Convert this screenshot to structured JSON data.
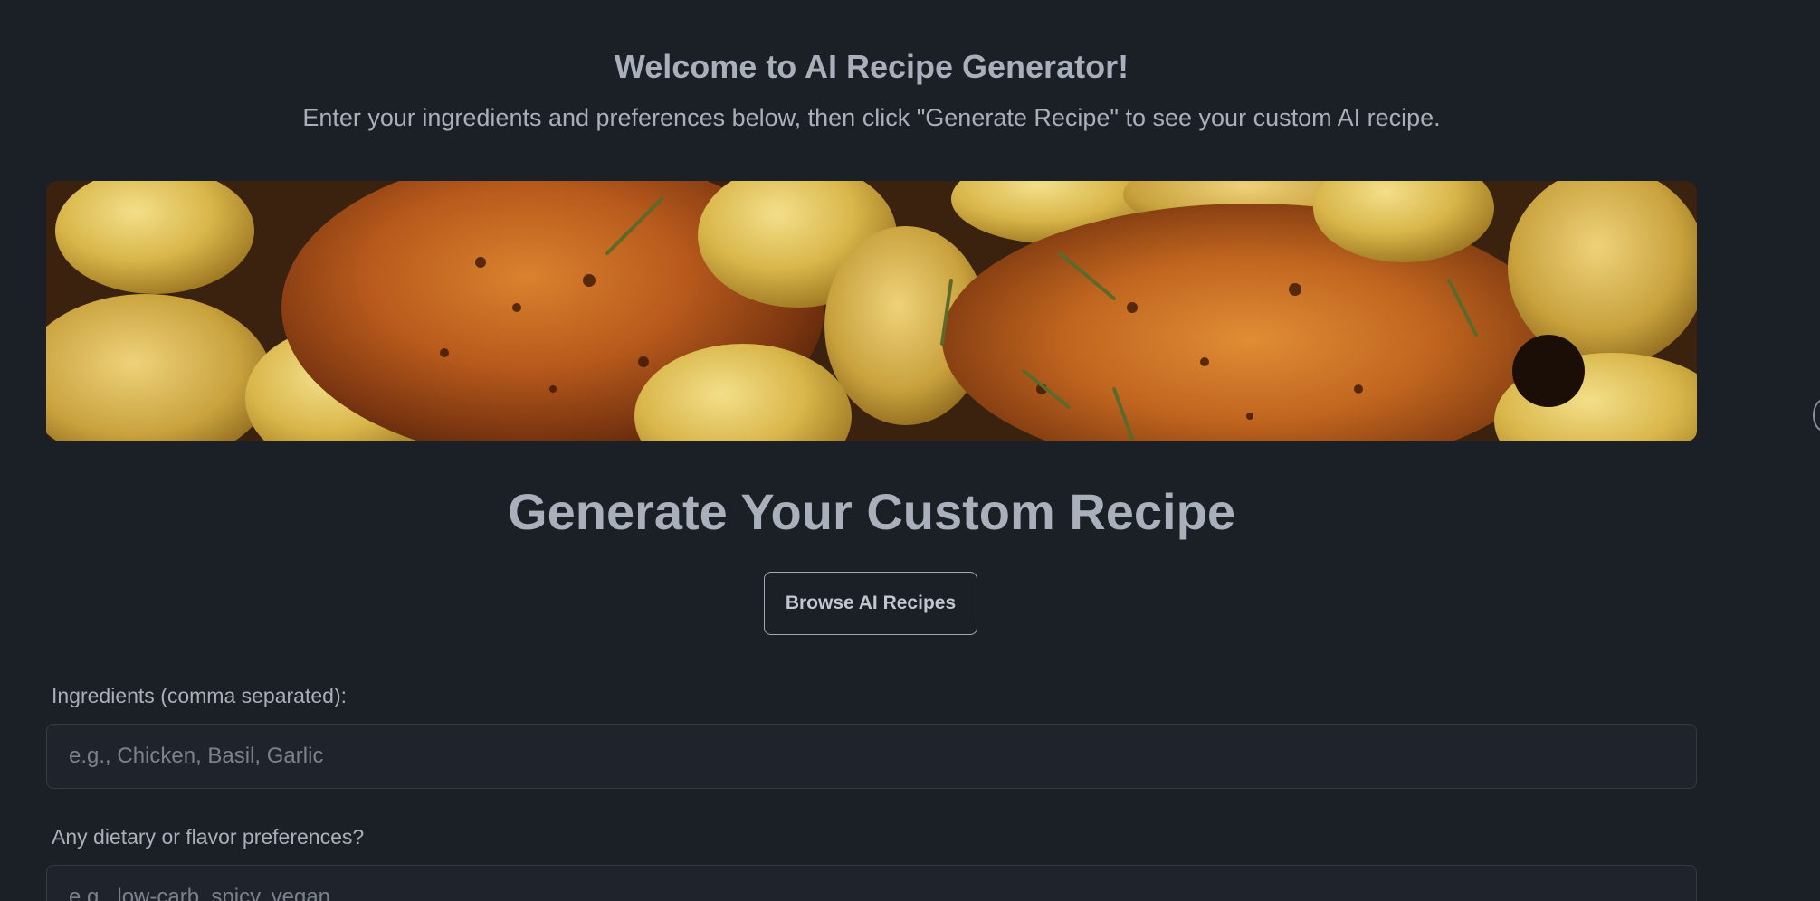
{
  "header": {
    "title": "Welcome to AI Recipe Generator!",
    "subtitle": "Enter your ingredients and preferences below, then click \"Generate Recipe\" to see your custom AI recipe."
  },
  "hero": {
    "image_alt": "roasted chicken thighs with baby potatoes and rosemary"
  },
  "generator": {
    "title": "Generate Your Custom Recipe",
    "browse_label": "Browse AI Recipes"
  },
  "form": {
    "ingredients_label": "Ingredients (comma separated):",
    "ingredients_placeholder": "e.g., Chicken, Basil, Garlic",
    "ingredients_value": "",
    "preferences_label": "Any dietary or flavor preferences?",
    "preferences_placeholder": "e.g., low-carb, spicy, vegan",
    "preferences_value": ""
  },
  "colors": {
    "background": "#1b1f26",
    "text": "#a9b0bc",
    "input_bg": "#1f242c",
    "input_border": "#343a44"
  }
}
